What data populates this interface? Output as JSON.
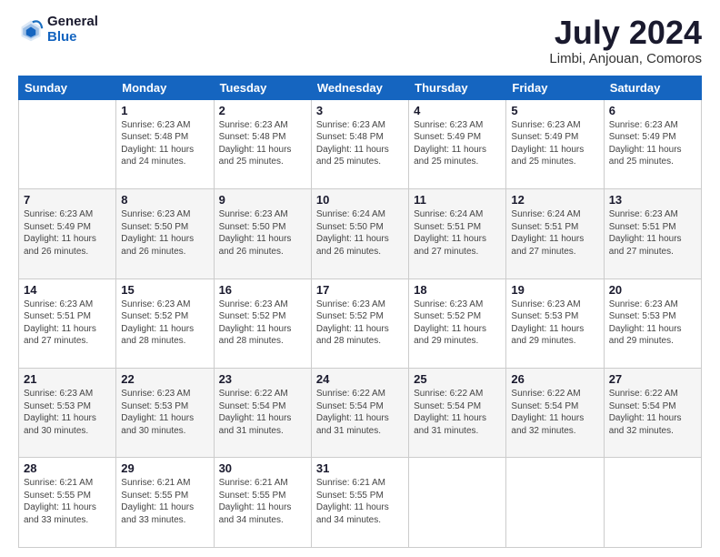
{
  "header": {
    "logo": {
      "line1": "General",
      "line2": "Blue"
    },
    "month_year": "July 2024",
    "location": "Limbi, Anjouan, Comoros"
  },
  "days_of_week": [
    "Sunday",
    "Monday",
    "Tuesday",
    "Wednesday",
    "Thursday",
    "Friday",
    "Saturday"
  ],
  "weeks": [
    [
      {
        "day": "",
        "info": ""
      },
      {
        "day": "1",
        "info": "Sunrise: 6:23 AM\nSunset: 5:48 PM\nDaylight: 11 hours\nand 24 minutes."
      },
      {
        "day": "2",
        "info": "Sunrise: 6:23 AM\nSunset: 5:48 PM\nDaylight: 11 hours\nand 25 minutes."
      },
      {
        "day": "3",
        "info": "Sunrise: 6:23 AM\nSunset: 5:48 PM\nDaylight: 11 hours\nand 25 minutes."
      },
      {
        "day": "4",
        "info": "Sunrise: 6:23 AM\nSunset: 5:49 PM\nDaylight: 11 hours\nand 25 minutes."
      },
      {
        "day": "5",
        "info": "Sunrise: 6:23 AM\nSunset: 5:49 PM\nDaylight: 11 hours\nand 25 minutes."
      },
      {
        "day": "6",
        "info": "Sunrise: 6:23 AM\nSunset: 5:49 PM\nDaylight: 11 hours\nand 25 minutes."
      }
    ],
    [
      {
        "day": "7",
        "info": "Sunrise: 6:23 AM\nSunset: 5:49 PM\nDaylight: 11 hours\nand 26 minutes."
      },
      {
        "day": "8",
        "info": "Sunrise: 6:23 AM\nSunset: 5:50 PM\nDaylight: 11 hours\nand 26 minutes."
      },
      {
        "day": "9",
        "info": "Sunrise: 6:23 AM\nSunset: 5:50 PM\nDaylight: 11 hours\nand 26 minutes."
      },
      {
        "day": "10",
        "info": "Sunrise: 6:24 AM\nSunset: 5:50 PM\nDaylight: 11 hours\nand 26 minutes."
      },
      {
        "day": "11",
        "info": "Sunrise: 6:24 AM\nSunset: 5:51 PM\nDaylight: 11 hours\nand 27 minutes."
      },
      {
        "day": "12",
        "info": "Sunrise: 6:24 AM\nSunset: 5:51 PM\nDaylight: 11 hours\nand 27 minutes."
      },
      {
        "day": "13",
        "info": "Sunrise: 6:23 AM\nSunset: 5:51 PM\nDaylight: 11 hours\nand 27 minutes."
      }
    ],
    [
      {
        "day": "14",
        "info": "Sunrise: 6:23 AM\nSunset: 5:51 PM\nDaylight: 11 hours\nand 27 minutes."
      },
      {
        "day": "15",
        "info": "Sunrise: 6:23 AM\nSunset: 5:52 PM\nDaylight: 11 hours\nand 28 minutes."
      },
      {
        "day": "16",
        "info": "Sunrise: 6:23 AM\nSunset: 5:52 PM\nDaylight: 11 hours\nand 28 minutes."
      },
      {
        "day": "17",
        "info": "Sunrise: 6:23 AM\nSunset: 5:52 PM\nDaylight: 11 hours\nand 28 minutes."
      },
      {
        "day": "18",
        "info": "Sunrise: 6:23 AM\nSunset: 5:52 PM\nDaylight: 11 hours\nand 29 minutes."
      },
      {
        "day": "19",
        "info": "Sunrise: 6:23 AM\nSunset: 5:53 PM\nDaylight: 11 hours\nand 29 minutes."
      },
      {
        "day": "20",
        "info": "Sunrise: 6:23 AM\nSunset: 5:53 PM\nDaylight: 11 hours\nand 29 minutes."
      }
    ],
    [
      {
        "day": "21",
        "info": "Sunrise: 6:23 AM\nSunset: 5:53 PM\nDaylight: 11 hours\nand 30 minutes."
      },
      {
        "day": "22",
        "info": "Sunrise: 6:23 AM\nSunset: 5:53 PM\nDaylight: 11 hours\nand 30 minutes."
      },
      {
        "day": "23",
        "info": "Sunrise: 6:22 AM\nSunset: 5:54 PM\nDaylight: 11 hours\nand 31 minutes."
      },
      {
        "day": "24",
        "info": "Sunrise: 6:22 AM\nSunset: 5:54 PM\nDaylight: 11 hours\nand 31 minutes."
      },
      {
        "day": "25",
        "info": "Sunrise: 6:22 AM\nSunset: 5:54 PM\nDaylight: 11 hours\nand 31 minutes."
      },
      {
        "day": "26",
        "info": "Sunrise: 6:22 AM\nSunset: 5:54 PM\nDaylight: 11 hours\nand 32 minutes."
      },
      {
        "day": "27",
        "info": "Sunrise: 6:22 AM\nSunset: 5:54 PM\nDaylight: 11 hours\nand 32 minutes."
      }
    ],
    [
      {
        "day": "28",
        "info": "Sunrise: 6:21 AM\nSunset: 5:55 PM\nDaylight: 11 hours\nand 33 minutes."
      },
      {
        "day": "29",
        "info": "Sunrise: 6:21 AM\nSunset: 5:55 PM\nDaylight: 11 hours\nand 33 minutes."
      },
      {
        "day": "30",
        "info": "Sunrise: 6:21 AM\nSunset: 5:55 PM\nDaylight: 11 hours\nand 34 minutes."
      },
      {
        "day": "31",
        "info": "Sunrise: 6:21 AM\nSunset: 5:55 PM\nDaylight: 11 hours\nand 34 minutes."
      },
      {
        "day": "",
        "info": ""
      },
      {
        "day": "",
        "info": ""
      },
      {
        "day": "",
        "info": ""
      }
    ]
  ]
}
